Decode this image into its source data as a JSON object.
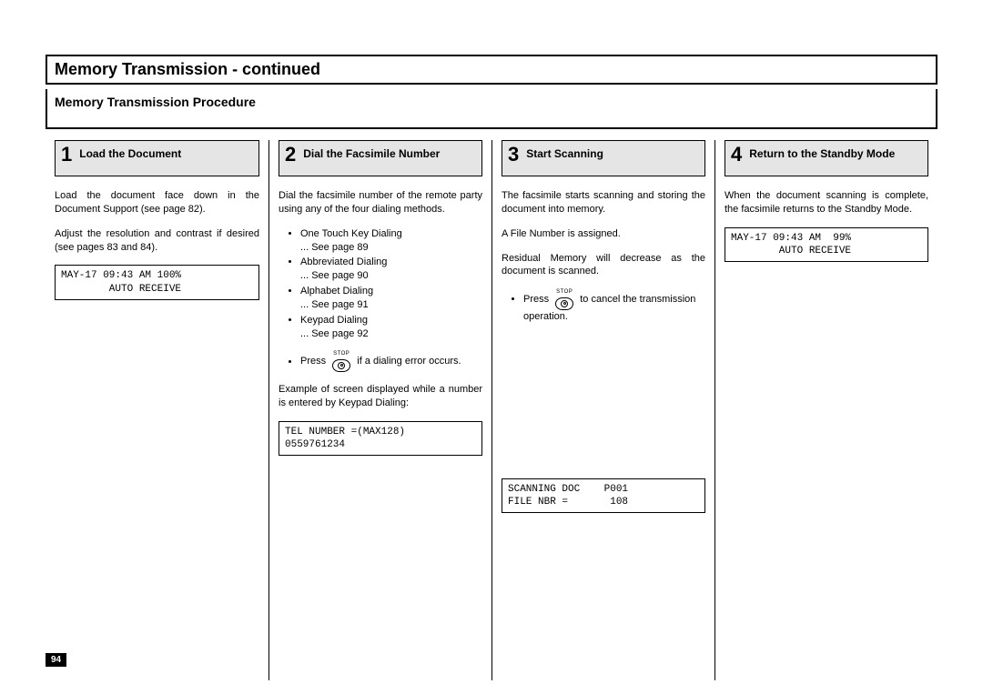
{
  "page": {
    "title": "Memory Transmission - continued",
    "subtitle": "Memory Transmission Procedure",
    "number": "94"
  },
  "steps": [
    {
      "num": "1",
      "title": "Load the Document",
      "p1": "Load the document face down in the Document Support (see page 82).",
      "p2": "Adjust the resolution and contrast if desired (see pages 83 and 84).",
      "lcd_l1": "MAY-17 09:43 AM 100%",
      "lcd_l2": "        AUTO RECEIVE"
    },
    {
      "num": "2",
      "title": "Dial the Facsimile Number",
      "p1": "Dial the facsimile number of the remote party using any of the four dialing methods.",
      "bullets": [
        {
          "t": "One Touch Key Dialing",
          "s": "... See page 89"
        },
        {
          "t": "Abbreviated Dialing",
          "s": "... See page 90"
        },
        {
          "t": "Alphabet Dialing",
          "s": "... See page 91"
        },
        {
          "t": "Keypad Dialing",
          "s": "... See page 92"
        }
      ],
      "press_pre": "Press",
      "press_post": "if a dialing error occurs.",
      "stop_label": "STOP",
      "p2": "Example of screen displayed while a number is entered by Keypad Dialing:",
      "lcd_l1": "TEL NUMBER =(MAX128)",
      "lcd_l2": "0559761234"
    },
    {
      "num": "3",
      "title": "Start Scanning",
      "p1": "The facsimile starts scanning and storing the document into memory.",
      "p2": "A File Number is assigned.",
      "p3": "Residual Memory will decrease as the document is scanned.",
      "press_pre": "Press",
      "press_post": "to cancel the transmission operation.",
      "stop_label": "STOP",
      "lcd_l1": "SCANNING DOC    P001",
      "lcd_l2": "FILE NBR =       108"
    },
    {
      "num": "4",
      "title": "Return to the Standby Mode",
      "p1": "When the document scanning is complete, the facsimile returns to the Standby Mode.",
      "lcd_l1": "MAY-17 09:43 AM  99%",
      "lcd_l2": "        AUTO RECEIVE"
    }
  ]
}
